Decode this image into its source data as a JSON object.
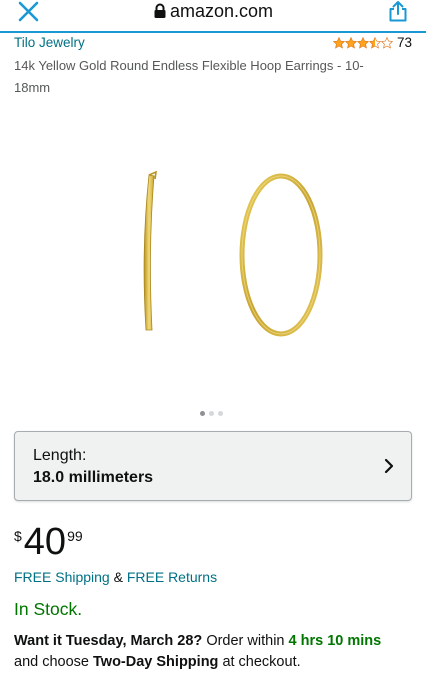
{
  "browser": {
    "url_text": "amazon.com"
  },
  "product": {
    "brand": "Tilo Jewelry",
    "rating": 3.5,
    "rating_count": "73",
    "title": "14k Yellow Gold Round Endless Flexible Hoop Earrings - 10-18mm",
    "image_alt": "Gold hoop earrings",
    "image_dots": {
      "count": 3,
      "active_index": 0
    },
    "variation": {
      "label": "Length:",
      "value": "18.0 millimeters"
    },
    "price": {
      "symbol": "$",
      "whole": "40",
      "fraction": "99"
    },
    "shipping": {
      "free_shipping": "FREE Shipping",
      "ampersand": "&",
      "free_returns": "FREE Returns"
    },
    "stock": "In Stock.",
    "delivery": {
      "lead": "Want it Tuesday, March 28?",
      "order_within": "Order within",
      "countdown": "4 hrs 10 mins",
      "and_choose": "and choose",
      "option": "Two-Day Shipping",
      "suffix": "at checkout."
    }
  },
  "colors": {
    "link": "#007185",
    "in_stock": "#007600",
    "star": "#ffa41c",
    "gold": "#d4b43c",
    "top_border": "#1a98d4"
  }
}
